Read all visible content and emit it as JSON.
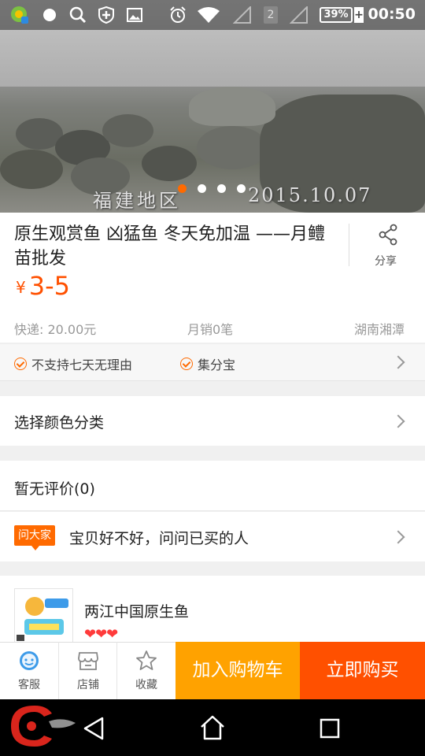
{
  "status_bar": {
    "battery": "39%",
    "time": "00:50",
    "sim_slot": "2",
    "icons": [
      "app-notification-icon",
      "dot-icon",
      "search-icon",
      "shield-icon",
      "image-icon",
      "alarm-icon",
      "wifi-icon",
      "signal-icon",
      "sim2-icon",
      "signal-icon",
      "battery-icon"
    ]
  },
  "hero": {
    "caption": "福建地区",
    "date": "2015.10.07",
    "slide_count": 4,
    "active_slide": 0
  },
  "product": {
    "title": "原生观赏鱼 凶猛鱼 冬天免加温 ——月鳢苗批发",
    "share_label": "分享",
    "currency": "¥",
    "price": "3-5",
    "shipping": "快递: 20.00元",
    "monthly_sales": "月销0笔",
    "location": "湖南湘潭"
  },
  "promises": {
    "items": [
      "不支持七天无理由",
      "集分宝"
    ]
  },
  "options": {
    "color_label": "选择颜色分类"
  },
  "reviews": {
    "label": "暂无评价(0)"
  },
  "ask": {
    "badge": "问大家",
    "prompt": "宝贝好不好，问问已买的人"
  },
  "shop": {
    "name": "两江中国原生鱼",
    "hearts": "❤❤❤",
    "rating_hearts": 3
  },
  "actions": {
    "service_label": "客服",
    "store_label": "店铺",
    "favorite_label": "收藏",
    "add_to_cart": "加入购物车",
    "buy_now": "立即购买"
  },
  "colors": {
    "accent": "#ff5000",
    "cart": "#ffa200",
    "icon_blue": "#3d9be9"
  }
}
